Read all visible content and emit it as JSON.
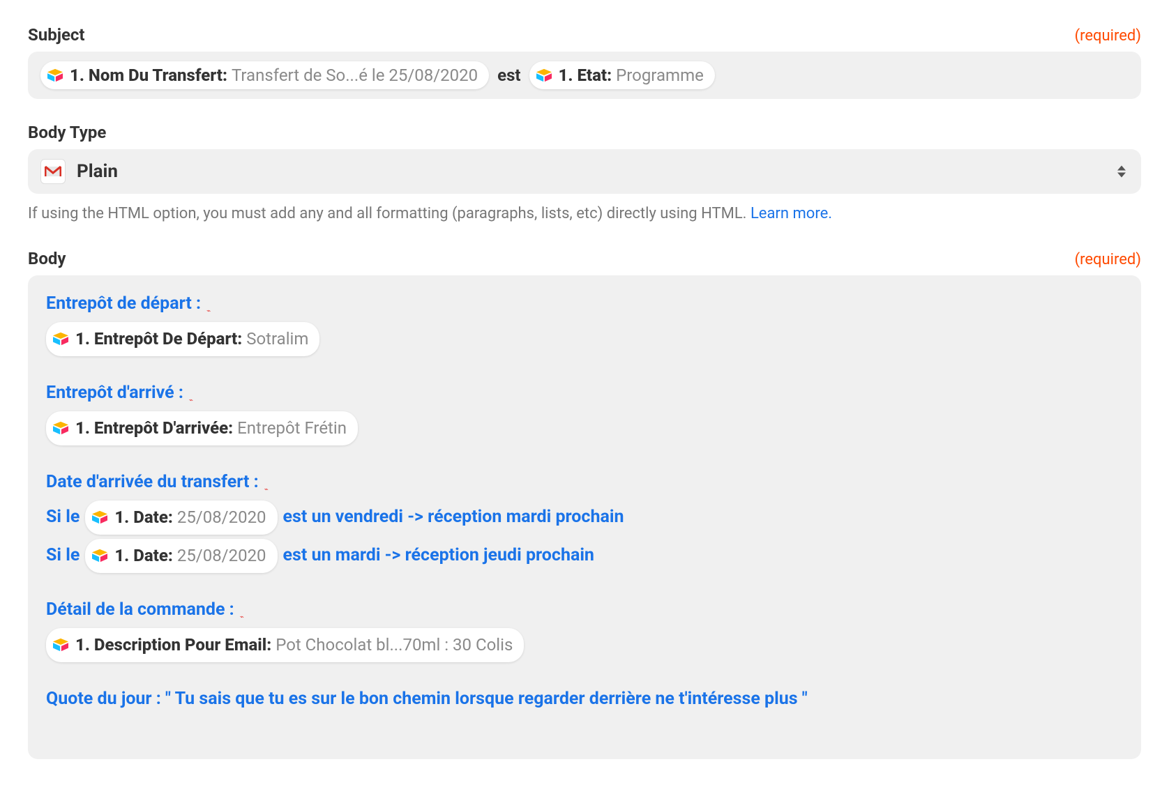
{
  "subject": {
    "label": "Subject",
    "required": "(required)",
    "pill1": {
      "label": "1. Nom Du Transfert:",
      "value": "Transfert de So...é le 25/08/2020"
    },
    "between": "est",
    "pill2": {
      "label": "1. Etat:",
      "value": "Programme"
    }
  },
  "bodyType": {
    "label": "Body Type",
    "value": "Plain",
    "help": "If using the HTML option, you must add any and all formatting (paragraphs, lists, etc) directly using HTML. ",
    "helpLink": "Learn more."
  },
  "body": {
    "label": "Body",
    "required": "(required)",
    "sec1": {
      "title": "Entrepôt de départ :",
      "pill": {
        "label": "1. Entrepôt De Départ:",
        "value": "Sotralim"
      }
    },
    "sec2": {
      "title": "Entrepôt d'arrivé :",
      "pill": {
        "label": "1. Entrepôt D'arrivée:",
        "value": "Entrepôt Frétin"
      }
    },
    "sec3": {
      "title": "Date d'arrivée du transfert :",
      "line1pre": "Si le",
      "line1pill": {
        "label": "1. Date:",
        "value": "25/08/2020"
      },
      "line1post": "est un vendredi -> réception mardi prochain",
      "line2pre": "Si le",
      "line2pill": {
        "label": "1. Date:",
        "value": "25/08/2020"
      },
      "line2post": "est un mardi -> réception jeudi prochain"
    },
    "sec4": {
      "title": "Détail de la commande :",
      "pill": {
        "label": "1. Description Pour Email:",
        "value": "Pot Chocolat bl...70ml : 30 Colis"
      }
    },
    "quote": "Quote du jour : \" Tu sais que tu es sur le bon chemin lorsque regarder derrière  ne t'intéresse plus \""
  }
}
